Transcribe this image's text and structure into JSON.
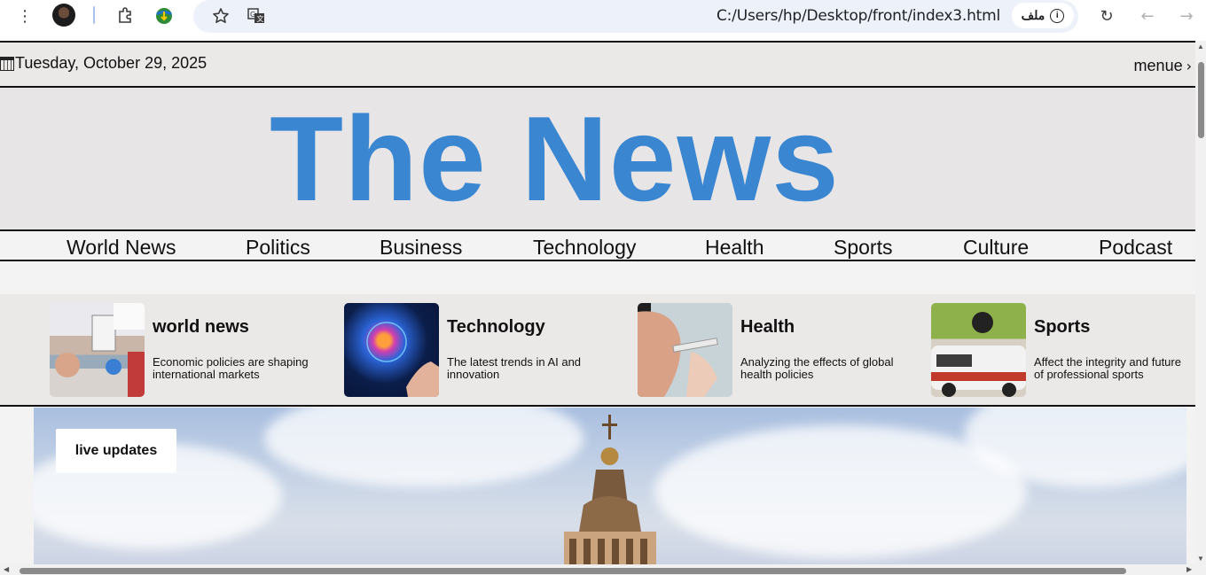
{
  "browser": {
    "url": "C:/Users/hp/Desktop/front/index3.html",
    "file_chip_label": "ملف"
  },
  "topbar": {
    "date": "Tuesday, October 29, 2025",
    "menu_label": "menue"
  },
  "masthead": {
    "title": "The News",
    "title_color": "#3a86d1"
  },
  "nav": {
    "items": [
      "World News",
      "Politics",
      "Business",
      "Technology",
      "Health",
      "Sports",
      "Culture",
      "Podcast"
    ]
  },
  "cards": [
    {
      "title": "world news",
      "desc": "Economic policies are shaping international markets",
      "image": "protest-photo"
    },
    {
      "title": "Technology",
      "desc": "The latest trends in AI and innovation",
      "image": "ai-brain-photo"
    },
    {
      "title": "Health",
      "desc": "Analyzing the effects of global health policies",
      "image": "vaccination-photo"
    },
    {
      "title": "Sports",
      "desc": "Affect the integrity and future of professional sports",
      "image": "racing-photo"
    }
  ],
  "hero": {
    "badge": "live updates",
    "image": "dome-under-cloudy-sky"
  }
}
